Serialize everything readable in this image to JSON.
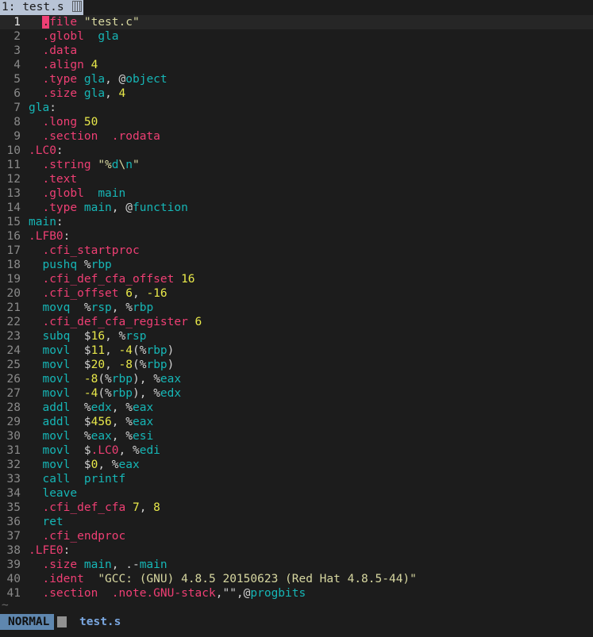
{
  "tab": {
    "label": "1: test.s",
    "icon": "file-type-glyph"
  },
  "statusbar": {
    "mode": "NORMAL",
    "filename": "test.s"
  },
  "tilde": "~",
  "lines": [
    [
      [
        "dir",
        ".file"
      ],
      [
        "sp",
        " "
      ],
      [
        "str",
        "\"test.c\""
      ]
    ],
    [
      [
        "dir",
        ".globl"
      ],
      [
        "sp",
        "  "
      ],
      [
        "lbl",
        "gla"
      ]
    ],
    [
      [
        "dir",
        ".data"
      ]
    ],
    [
      [
        "dir",
        ".align"
      ],
      [
        "sp",
        " "
      ],
      [
        "num",
        "4"
      ]
    ],
    [
      [
        "dir",
        ".type"
      ],
      [
        "sp",
        " "
      ],
      [
        "lbl",
        "gla"
      ],
      [
        "sym",
        ", @"
      ],
      [
        "lbl",
        "object"
      ]
    ],
    [
      [
        "dir",
        ".size"
      ],
      [
        "sp",
        " "
      ],
      [
        "lbl",
        "gla"
      ],
      [
        "sym",
        ", "
      ],
      [
        "num",
        "4"
      ]
    ],
    [
      [
        "lbl",
        "gla"
      ],
      [
        "sym",
        ":"
      ]
    ],
    [
      [
        "dir",
        ".long"
      ],
      [
        "sp",
        " "
      ],
      [
        "num",
        "50"
      ]
    ],
    [
      [
        "dir",
        ".section"
      ],
      [
        "sp",
        "  "
      ],
      [
        "dir",
        ".rodata"
      ]
    ],
    [
      [
        "dir",
        ".LC0"
      ],
      [
        "sym",
        ":"
      ]
    ],
    [
      [
        "dir",
        ".string"
      ],
      [
        "sp",
        " "
      ],
      [
        "str",
        "\"%"
      ],
      [
        "lbl",
        "d"
      ],
      [
        "str",
        "\\"
      ],
      [
        "lbl",
        "n"
      ],
      [
        "str",
        "\""
      ]
    ],
    [
      [
        "dir",
        ".text"
      ]
    ],
    [
      [
        "dir",
        ".globl"
      ],
      [
        "sp",
        "  "
      ],
      [
        "lbl",
        "main"
      ]
    ],
    [
      [
        "dir",
        ".type"
      ],
      [
        "sp",
        " "
      ],
      [
        "lbl",
        "main"
      ],
      [
        "sym",
        ", @"
      ],
      [
        "lbl",
        "function"
      ]
    ],
    [
      [
        "lbl",
        "main"
      ],
      [
        "sym",
        ":"
      ]
    ],
    [
      [
        "dir",
        ".LFB0"
      ],
      [
        "sym",
        ":"
      ]
    ],
    [
      [
        "dir",
        ".cfi_startproc"
      ]
    ],
    [
      [
        "ins",
        "pushq"
      ],
      [
        "sp",
        " "
      ],
      [
        "sym",
        "%"
      ],
      [
        "reg",
        "rbp"
      ]
    ],
    [
      [
        "dir",
        ".cfi_def_cfa_offset"
      ],
      [
        "sp",
        " "
      ],
      [
        "num",
        "16"
      ]
    ],
    [
      [
        "dir",
        ".cfi_offset"
      ],
      [
        "sp",
        " "
      ],
      [
        "num",
        "6"
      ],
      [
        "sym",
        ", "
      ],
      [
        "num",
        "-16"
      ]
    ],
    [
      [
        "ins",
        "movq"
      ],
      [
        "sp",
        "  "
      ],
      [
        "sym",
        "%"
      ],
      [
        "reg",
        "rsp"
      ],
      [
        "sym",
        ", %"
      ],
      [
        "reg",
        "rbp"
      ]
    ],
    [
      [
        "dir",
        ".cfi_def_cfa_register"
      ],
      [
        "sp",
        " "
      ],
      [
        "num",
        "6"
      ]
    ],
    [
      [
        "ins",
        "subq"
      ],
      [
        "sp",
        "  "
      ],
      [
        "sym",
        "$"
      ],
      [
        "num",
        "16"
      ],
      [
        "sym",
        ", %"
      ],
      [
        "reg",
        "rsp"
      ]
    ],
    [
      [
        "ins",
        "movl"
      ],
      [
        "sp",
        "  "
      ],
      [
        "sym",
        "$"
      ],
      [
        "num",
        "11"
      ],
      [
        "sym",
        ", "
      ],
      [
        "num",
        "-4"
      ],
      [
        "sym",
        "(%"
      ],
      [
        "reg",
        "rbp"
      ],
      [
        "sym",
        ")"
      ]
    ],
    [
      [
        "ins",
        "movl"
      ],
      [
        "sp",
        "  "
      ],
      [
        "sym",
        "$"
      ],
      [
        "num",
        "20"
      ],
      [
        "sym",
        ", "
      ],
      [
        "num",
        "-8"
      ],
      [
        "sym",
        "(%"
      ],
      [
        "reg",
        "rbp"
      ],
      [
        "sym",
        ")"
      ]
    ],
    [
      [
        "ins",
        "movl"
      ],
      [
        "sp",
        "  "
      ],
      [
        "num",
        "-8"
      ],
      [
        "sym",
        "(%"
      ],
      [
        "reg",
        "rbp"
      ],
      [
        "sym",
        "), %"
      ],
      [
        "reg",
        "eax"
      ]
    ],
    [
      [
        "ins",
        "movl"
      ],
      [
        "sp",
        "  "
      ],
      [
        "num",
        "-4"
      ],
      [
        "sym",
        "(%"
      ],
      [
        "reg",
        "rbp"
      ],
      [
        "sym",
        "), %"
      ],
      [
        "reg",
        "edx"
      ]
    ],
    [
      [
        "ins",
        "addl"
      ],
      [
        "sp",
        "  "
      ],
      [
        "sym",
        "%"
      ],
      [
        "reg",
        "edx"
      ],
      [
        "sym",
        ", %"
      ],
      [
        "reg",
        "eax"
      ]
    ],
    [
      [
        "ins",
        "addl"
      ],
      [
        "sp",
        "  "
      ],
      [
        "sym",
        "$"
      ],
      [
        "num",
        "456"
      ],
      [
        "sym",
        ", %"
      ],
      [
        "reg",
        "eax"
      ]
    ],
    [
      [
        "ins",
        "movl"
      ],
      [
        "sp",
        "  "
      ],
      [
        "sym",
        "%"
      ],
      [
        "reg",
        "eax"
      ],
      [
        "sym",
        ", %"
      ],
      [
        "reg",
        "esi"
      ]
    ],
    [
      [
        "ins",
        "movl"
      ],
      [
        "sp",
        "  "
      ],
      [
        "sym",
        "$"
      ],
      [
        "dir",
        ".LC0"
      ],
      [
        "sym",
        ", %"
      ],
      [
        "reg",
        "edi"
      ]
    ],
    [
      [
        "ins",
        "movl"
      ],
      [
        "sp",
        "  "
      ],
      [
        "sym",
        "$"
      ],
      [
        "num",
        "0"
      ],
      [
        "sym",
        ", %"
      ],
      [
        "reg",
        "eax"
      ]
    ],
    [
      [
        "ins",
        "call"
      ],
      [
        "sp",
        "  "
      ],
      [
        "lbl",
        "printf"
      ]
    ],
    [
      [
        "ins",
        "leave"
      ]
    ],
    [
      [
        "dir",
        ".cfi_def_cfa"
      ],
      [
        "sp",
        " "
      ],
      [
        "num",
        "7"
      ],
      [
        "sym",
        ", "
      ],
      [
        "num",
        "8"
      ]
    ],
    [
      [
        "ins",
        "ret"
      ]
    ],
    [
      [
        "dir",
        ".cfi_endproc"
      ]
    ],
    [
      [
        "dir",
        ".LFE0"
      ],
      [
        "sym",
        ":"
      ]
    ],
    [
      [
        "dir",
        ".size"
      ],
      [
        "sp",
        " "
      ],
      [
        "lbl",
        "main"
      ],
      [
        "sym",
        ", .-"
      ],
      [
        "lbl",
        "main"
      ]
    ],
    [
      [
        "dir",
        ".ident"
      ],
      [
        "sp",
        "  "
      ],
      [
        "str",
        "\"GCC: (GNU) 4.8.5 20150623 (Red Hat 4.8.5-44)\""
      ]
    ],
    [
      [
        "dir",
        ".section"
      ],
      [
        "sp",
        "  "
      ],
      [
        "dir",
        ".note.GNU-stack"
      ],
      [
        "sym",
        ",\"\",@"
      ],
      [
        "lbl",
        "progbits"
      ]
    ]
  ],
  "indent": [
    1,
    1,
    1,
    1,
    1,
    1,
    0,
    1,
    1,
    0,
    1,
    1,
    1,
    1,
    0,
    0,
    1,
    1,
    1,
    1,
    1,
    1,
    1,
    1,
    1,
    1,
    1,
    1,
    1,
    1,
    1,
    1,
    1,
    1,
    1,
    1,
    1,
    0,
    1,
    1,
    1
  ],
  "current_line": 1
}
